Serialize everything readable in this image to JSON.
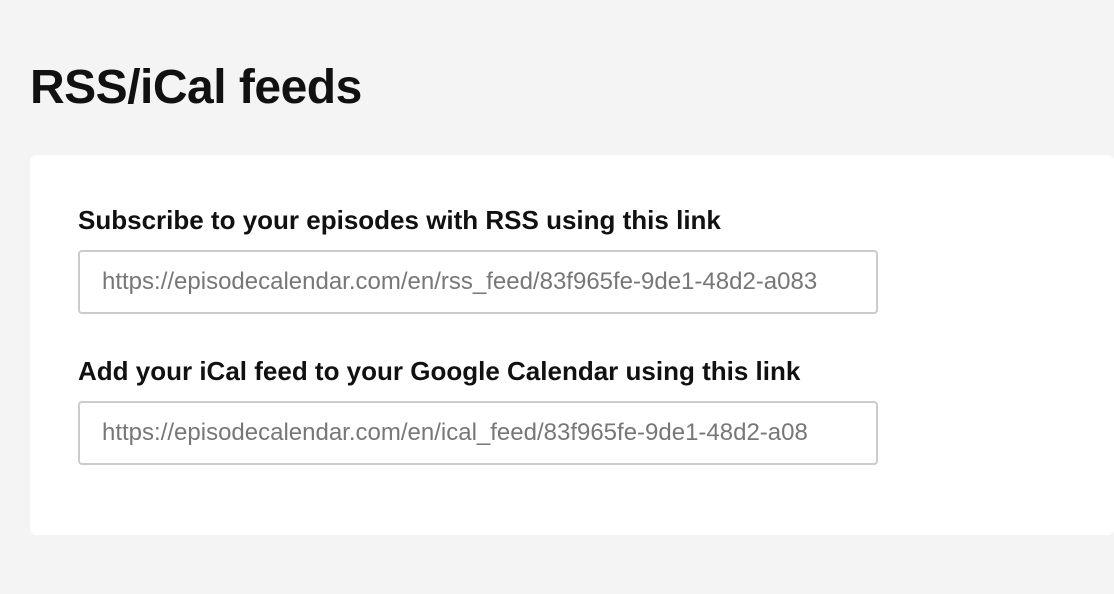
{
  "page": {
    "title": "RSS/iCal feeds"
  },
  "feeds": {
    "rss": {
      "label": "Subscribe to your episodes with RSS using this link",
      "url": "https://episodecalendar.com/en/rss_feed/83f965fe-9de1-48d2-a083"
    },
    "ical": {
      "label": "Add your iCal feed to your Google Calendar using this link",
      "url": "https://episodecalendar.com/en/ical_feed/83f965fe-9de1-48d2-a08"
    }
  }
}
